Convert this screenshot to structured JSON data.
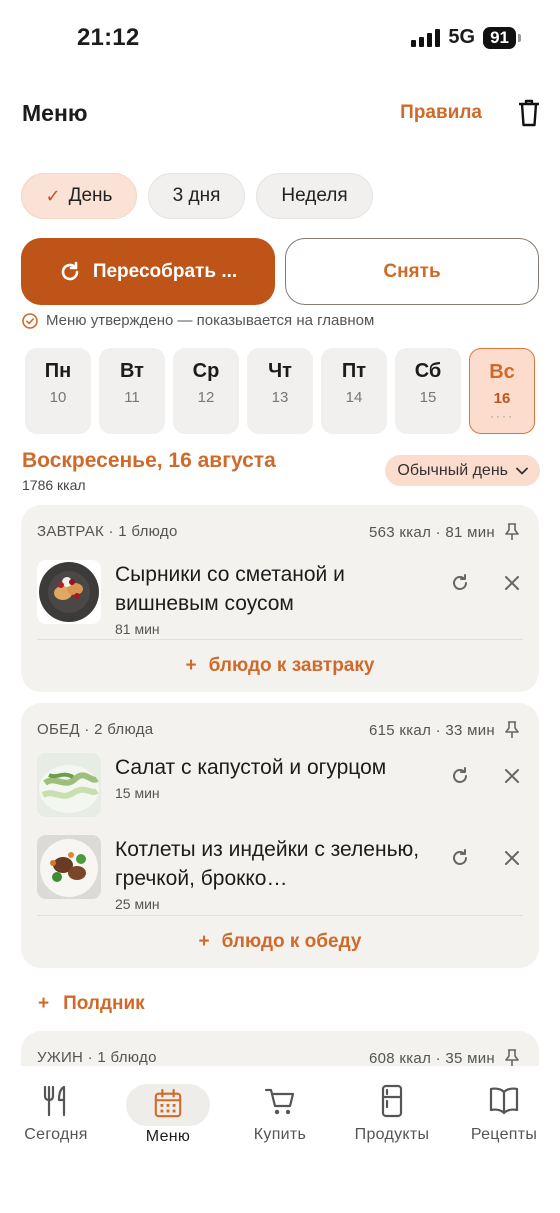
{
  "status": {
    "time": "21:12",
    "network": "5G",
    "battery": "91"
  },
  "header": {
    "title": "Меню",
    "rules_label": "Правила"
  },
  "period_chips": [
    {
      "label": "День",
      "active": true
    },
    {
      "label": "3 дня",
      "active": false
    },
    {
      "label": "Неделя",
      "active": false
    }
  ],
  "actions": {
    "rebuild_label": "Пересобрать ...",
    "remove_label": "Снять"
  },
  "approved_note": "Меню утверждено — показывается на главном",
  "days": [
    {
      "name": "Пн",
      "date": "10"
    },
    {
      "name": "Вт",
      "date": "11"
    },
    {
      "name": "Ср",
      "date": "12"
    },
    {
      "name": "Чт",
      "date": "13"
    },
    {
      "name": "Пт",
      "date": "14"
    },
    {
      "name": "Сб",
      "date": "15"
    },
    {
      "name": "Вс",
      "date": "16",
      "selected": true,
      "dots": "····"
    }
  ],
  "selected_day": {
    "title": "Воскресенье, 16 августа",
    "kcal": "1786 ккал",
    "day_type": "Обычный день"
  },
  "meals": {
    "breakfast": {
      "title": "ЗАВТРАК · 1 блюдо",
      "stats": "563 ккал · 81 мин",
      "dishes": [
        {
          "name": "Сырники со сметаной и вишневым соусом",
          "time": "81 мин"
        }
      ],
      "add_label": "блюдо к завтраку"
    },
    "lunch": {
      "title": "ОБЕД · 2 блюда",
      "stats": "615 ккал · 33 мин",
      "dishes": [
        {
          "name": "Салат с капустой и огурцом",
          "time": "15 мин"
        },
        {
          "name": "Котлеты из индейки с зеленью, гречкой, брокко…",
          "time": "25 мин"
        }
      ],
      "add_label": "блюдо к обеду"
    },
    "snack": {
      "add_label": "Полдник"
    },
    "dinner": {
      "title": "УЖИН · 1 блюдо",
      "stats": "608 ккал · 35 мин"
    }
  },
  "tabs": [
    {
      "label": "Сегодня",
      "icon": "fork-knife-icon"
    },
    {
      "label": "Меню",
      "icon": "calendar-icon",
      "active": true
    },
    {
      "label": "Купить",
      "icon": "cart-icon"
    },
    {
      "label": "Продукты",
      "icon": "fridge-icon"
    },
    {
      "label": "Рецепты",
      "icon": "book-icon"
    }
  ],
  "colors": {
    "accent": "#D06A2A",
    "accent_dark": "#BF5418",
    "accent_soft": "#FBDCCD",
    "card_bg": "#F3F2EF"
  }
}
